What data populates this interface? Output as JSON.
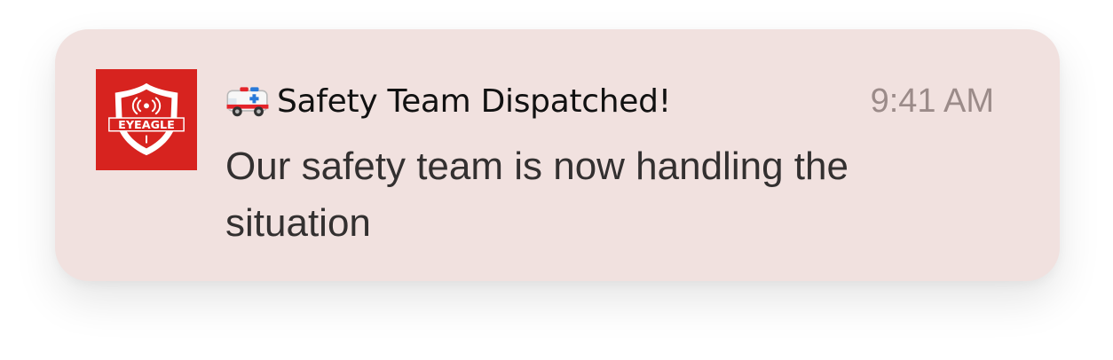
{
  "notification": {
    "app_icon": {
      "name": "eyeagle-logo-icon",
      "logo_text": "EYEAGLE",
      "background_color": "#d7231f"
    },
    "emoji_icon": "ambulance-emoji-icon",
    "title": "Safety Team Dispatched!",
    "time": "9:41 AM",
    "message": "Our safety team is now handling the situation",
    "colors": {
      "card_background": "#f1e1df",
      "title": "#111111",
      "time": "#9b8b89",
      "message": "#333030"
    }
  }
}
